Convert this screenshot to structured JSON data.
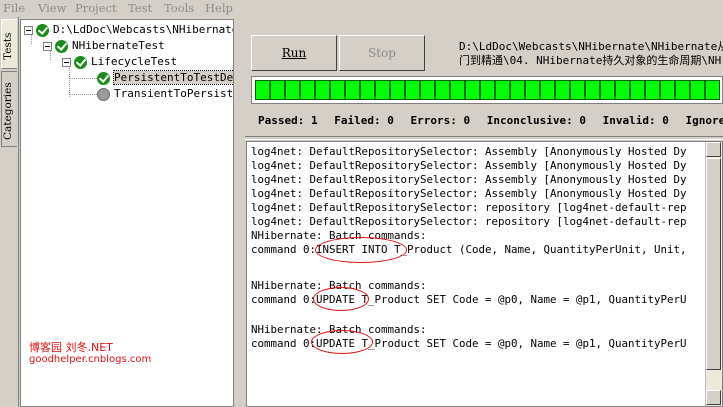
{
  "menu": [
    "File",
    "View",
    "Project",
    "Test",
    "Tools",
    "Help"
  ],
  "vtabs": [
    "Tests",
    "Categories"
  ],
  "tree": {
    "root": "D:\\LdDoc\\Webcasts\\NHibernate\\",
    "project": "NHibernateTest",
    "fixture": "LifecycleTest",
    "test_pass": "PersistentToTestDet",
    "test_skip": "TransientToPersiste"
  },
  "buttons": {
    "run": "Run",
    "stop": "Stop"
  },
  "path_lines": [
    "D:\\LdDoc\\Webcasts\\NHibernate\\NHibernate从入",
    "门到精通\\04. NHibernate持久对象的生命周期\\NH"
  ],
  "progress": {
    "segments": 31,
    "fraction": 1.0
  },
  "stats": [
    "Passed: 1",
    "Failed: 0",
    "Errors: 0",
    "Inconclusive: 0",
    "Invalid: 0",
    "Ignored:"
  ],
  "output_lines": [
    "log4net: DefaultRepositorySelector: Assembly [Anonymously Hosted Dy",
    "log4net: DefaultRepositorySelector: Assembly [Anonymously Hosted Dy",
    "log4net: DefaultRepositorySelector: Assembly [Anonymously Hosted Dy",
    "log4net: DefaultRepositorySelector: Assembly [Anonymously Hosted Dy",
    "log4net: DefaultRepositorySelector: repository [log4net-default-rep",
    "log4net: DefaultRepositorySelector: repository [log4net-default-rep",
    "NHibernate: Batch commands:",
    "command 0:INSERT INTO T_Product (Code, Name, QuantityPerUnit, Unit,",
    "",
    "NHibernate: Batch commands:",
    "command 0:UPDATE T_Product SET Code = @p0, Name = @p1, QuantityPerU",
    "",
    "NHibernate: Batch commands:",
    "command 0:UPDATE T_Product SET Code = @p0, Name = @p1, QuantityPerU"
  ],
  "watermark": {
    "line1": "博客园  刘冬.NET",
    "line2": "goodhelper.cnblogs.com"
  },
  "colors": {
    "progress": "#00ff00",
    "annotation": "#e01010",
    "pass": "#1a8a1a"
  }
}
